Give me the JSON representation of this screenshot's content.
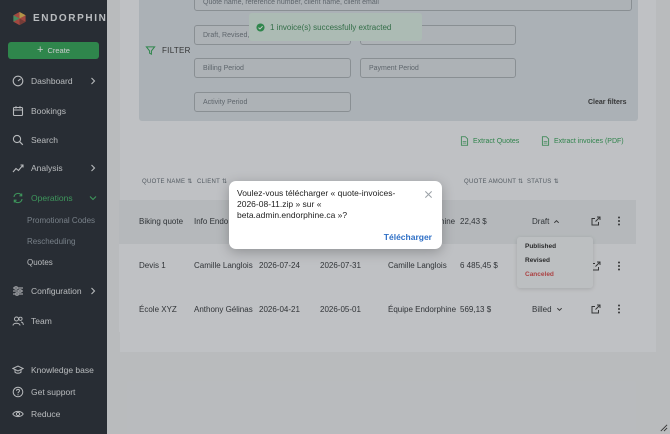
{
  "sidebar": {
    "brand": "ENDORPHINE",
    "create_label": "Create",
    "items": [
      {
        "label": "Dashboard"
      },
      {
        "label": "Bookings"
      },
      {
        "label": "Search"
      },
      {
        "label": "Analysis"
      },
      {
        "label": "Operations"
      },
      {
        "label": "Configuration"
      },
      {
        "label": "Team"
      }
    ],
    "sub_items": [
      {
        "label": "Promotional Codes"
      },
      {
        "label": "Rescheduling"
      },
      {
        "label": "Quotes"
      }
    ],
    "bottom": [
      {
        "label": "Knowledge base"
      },
      {
        "label": "Get support"
      },
      {
        "label": "Reduce"
      }
    ]
  },
  "filters": {
    "label": "FILTER",
    "search_placeholder": "Quote name, reference number, client name, client email",
    "status_placeholder": "Draft, Revised, ...",
    "billing_period": "Billing Period",
    "payment_period": "Payment Period",
    "activity_period": "Activity Period",
    "clear": "Clear filters"
  },
  "toast": {
    "message": "1 invoice(s) successfully extracted"
  },
  "actions": {
    "extract_quotes": "Extract Quotes",
    "extract_invoices": "Extract invoices (PDF)"
  },
  "table": {
    "headers": {
      "quote_name": "QUOTE NAME",
      "client": "CLIENT",
      "quote_amount": "QUOTE AMOUNT",
      "status": "STATUS"
    },
    "rows": [
      {
        "name": "Biking quote",
        "client": "Info Endo",
        "date1": "",
        "date2": "",
        "owner": "hine",
        "amount": "22,43 $",
        "status": "Draft"
      },
      {
        "name": "Devis 1",
        "client": "Camille Langlois",
        "date1": "2026-07-24",
        "date2": "2026-07-31",
        "owner": "Camille Langlois",
        "amount": "6 485,45 $",
        "status": ""
      },
      {
        "name": "École XYZ",
        "client": "Anthony Gélinas",
        "date1": "2026-04-21",
        "date2": "2026-05-01",
        "owner": "Équipe Endorphine",
        "amount": "569,13 $",
        "status": "Billed"
      }
    ]
  },
  "status_menu": {
    "options": [
      {
        "label": "Published",
        "color": "#222222"
      },
      {
        "label": "Revised",
        "color": "#222222"
      },
      {
        "label": "Canceled",
        "color": "#d64545"
      }
    ]
  },
  "dialog": {
    "message": "Voulez-vous télécharger « quote-invoices-2026-08-11.zip » sur « beta.admin.endorphine.ca »?",
    "download_label": "Télécharger"
  },
  "colors": {
    "accent": "#2aa150",
    "sidebar_bg": "#20262e",
    "link": "#2e6fc6"
  }
}
